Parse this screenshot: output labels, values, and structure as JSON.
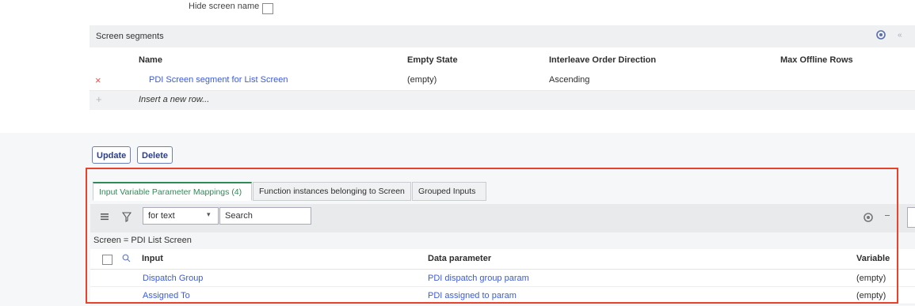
{
  "hide_screen_name": {
    "label": "Hide screen name",
    "checked": false
  },
  "segments": {
    "title": "Screen segments",
    "columns": [
      "Name",
      "Empty State",
      "Interleave Order Direction",
      "Max Offline Rows"
    ],
    "row": {
      "name": "PDI Screen segment for List Screen",
      "empty_state": "(empty)",
      "direction": "Ascending",
      "max_offline": ""
    },
    "insert_label": "Insert a new row..."
  },
  "actions": {
    "update": "Update",
    "delete": "Delete"
  },
  "tabs": [
    {
      "label": "Input Variable Parameter Mappings (4)",
      "active": true
    },
    {
      "label": "Function instances belonging to Screen",
      "active": false
    },
    {
      "label": "Grouped Inputs",
      "active": false
    }
  ],
  "toolbar": {
    "field_select": "for text",
    "search_placeholder": "Search"
  },
  "filter": {
    "text": "Screen = PDI List Screen"
  },
  "list": {
    "columns": [
      "Input",
      "Data parameter",
      "Variable"
    ],
    "rows": [
      {
        "input": "Dispatch Group",
        "data_parameter": "PDI dispatch group param",
        "variable": "(empty)"
      },
      {
        "input": "Assigned To",
        "data_parameter": "PDI assigned to param",
        "variable": "(empty)"
      }
    ]
  },
  "colors": {
    "accent_link": "#3b5bdb",
    "highlight_frame": "#e7432c",
    "active_tab": "#2e8b57"
  }
}
